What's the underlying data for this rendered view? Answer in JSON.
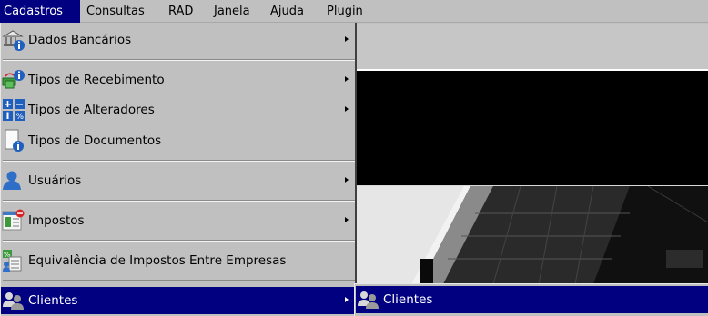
{
  "menubar": {
    "items": [
      {
        "label": "Cadastros"
      },
      {
        "label": "Consultas"
      },
      {
        "label": "RAD"
      },
      {
        "label": "Janela"
      },
      {
        "label": "Ajuda"
      },
      {
        "label": "Plugin"
      }
    ]
  },
  "dropdown": {
    "items": [
      {
        "label": "Dados Bancários",
        "icon": "bank-info-icon",
        "submenu": true
      },
      {
        "label": "Tipos de Recebimento",
        "icon": "money-info-icon",
        "submenu": true
      },
      {
        "label": "Tipos de Alteradores",
        "icon": "calculator-info-icon",
        "submenu": true
      },
      {
        "label": "Tipos de Documentos",
        "icon": "document-info-icon",
        "submenu": false
      },
      {
        "label": "Usuários",
        "icon": "user-icon",
        "submenu": true
      },
      {
        "label": "Impostos",
        "icon": "tax-icon",
        "submenu": true
      },
      {
        "label": "Equivalência de Impostos Entre Empresas",
        "icon": "tax-equivalence-icon",
        "submenu": false
      },
      {
        "label": "Clientes",
        "icon": "clients-icon",
        "submenu": true,
        "selected": true
      }
    ]
  },
  "submenu": {
    "items": [
      {
        "label": "Clientes",
        "icon": "clients-icon",
        "selected": true
      }
    ]
  },
  "colors": {
    "menu_bg": "#c0c0c0",
    "highlight": "#000080",
    "highlight_text": "#ffffff"
  }
}
